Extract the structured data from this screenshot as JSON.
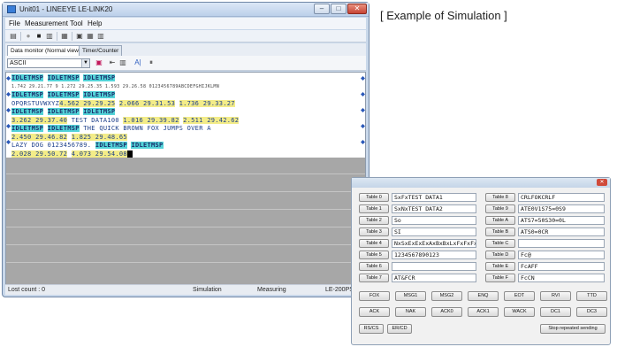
{
  "window": {
    "title": "Unit01 - LINEEYE LE-LINK20",
    "min": "–",
    "max": "□",
    "close": "✕"
  },
  "menu": [
    "File",
    "Measurement",
    "Tool",
    "Help"
  ],
  "tabs": [
    "Data monitor (Normal view)",
    "Timer/Counter"
  ],
  "ascii_select": "ASCII",
  "toolbar_glyphs": {
    "save": "▤",
    "record": "●",
    "stop": "■",
    "print": "▥",
    "copy": "▦",
    "find": "▣",
    "pause": "⏸",
    "ai": "A|",
    "filter": "⇤"
  },
  "monitor_rows": [
    {
      "kind": "text",
      "segments": [
        {
          "c": "cyan",
          "t": "IDLE"
        },
        {
          "c": "cyan",
          "t": "TMSP"
        },
        {
          "c": "white",
          "t": " "
        },
        {
          "c": "cyan",
          "t": "IDLE"
        },
        {
          "c": "cyan",
          "t": "TMSP"
        },
        {
          "c": "white",
          "t": " "
        },
        {
          "c": "cyan",
          "t": "IDLE"
        },
        {
          "c": "cyan",
          "t": "TMSP"
        }
      ]
    },
    {
      "kind": "meta",
      "text": "1.742 29.21.77 9 1.272 29.25.35 1.593 29.26.58 0123456789ABCDEFGHIJKLMN"
    },
    {
      "kind": "text",
      "segments": [
        {
          "c": "white",
          "t": "                            "
        },
        {
          "c": "cyan",
          "t": "IDLE"
        },
        {
          "c": "cyan",
          "t": "TMSP"
        },
        {
          "c": "white",
          "t": " "
        },
        {
          "c": "cyan",
          "t": "IDLE"
        },
        {
          "c": "cyan",
          "t": "TMSP"
        },
        {
          "c": "white",
          "t": " "
        },
        {
          "c": "cyan",
          "t": "IDLE"
        },
        {
          "c": "cyan",
          "t": "TMSP"
        }
      ]
    },
    {
      "kind": "text",
      "segments": [
        {
          "c": "white",
          "t": "OPQRSTUVWXYZ"
        },
        {
          "c": "yellow",
          "t": "4.562 29.29.25"
        },
        {
          "c": "white",
          "t": "  "
        },
        {
          "c": "yellow",
          "t": "2.066 29.31.53"
        },
        {
          "c": "white",
          "t": "  "
        },
        {
          "c": "yellow",
          "t": "1.736 29.33.27"
        }
      ]
    },
    {
      "kind": "text",
      "segments": [
        {
          "c": "cyan",
          "t": "IDLE"
        },
        {
          "c": "cyan",
          "t": "TMSP"
        },
        {
          "c": "white",
          "t": "                          "
        },
        {
          "c": "cyan",
          "t": "IDLE"
        },
        {
          "c": "cyan",
          "t": "TMSP"
        },
        {
          "c": "white",
          "t": " "
        },
        {
          "c": "cyan",
          "t": "IDLE"
        },
        {
          "c": "cyan",
          "t": "TMSP"
        }
      ]
    },
    {
      "kind": "text",
      "segments": [
        {
          "c": "yellow",
          "t": "3.262 29.37.40"
        },
        {
          "c": "white",
          "t": "  TEST DATA100  "
        },
        {
          "c": "yellow",
          "t": "1.016 29.39.82"
        },
        {
          "c": "white",
          "t": "  "
        },
        {
          "c": "yellow",
          "t": "2.511 29.42.62"
        }
      ]
    },
    {
      "kind": "text",
      "segments": [
        {
          "c": "cyan",
          "t": "IDLE"
        },
        {
          "c": "cyan",
          "t": "TMSP"
        },
        {
          "c": "white",
          "t": " "
        },
        {
          "c": "cyan",
          "t": "IDLE"
        },
        {
          "c": "cyan",
          "t": "TMSP"
        },
        {
          "c": "white",
          "t": " THE QUICK BROWN FOX JUMPS OVER A"
        }
      ]
    },
    {
      "kind": "text",
      "segments": [
        {
          "c": "yellow",
          "t": "2.450 29.46.82"
        },
        {
          "c": "white",
          "t": "  "
        },
        {
          "c": "yellow",
          "t": "1.825 29.48.65"
        }
      ]
    },
    {
      "kind": "text",
      "segments": [
        {
          "c": "white",
          "t": "LAZY DOG 0123456789.  "
        },
        {
          "c": "cyan",
          "t": "IDLE"
        },
        {
          "c": "cyan",
          "t": "TMSP"
        },
        {
          "c": "white",
          "t": " "
        },
        {
          "c": "cyan",
          "t": "IDLE"
        },
        {
          "c": "cyan",
          "t": "TMSP"
        }
      ]
    },
    {
      "kind": "text",
      "segments": [
        {
          "c": "white",
          "t": "                      "
        },
        {
          "c": "yellow",
          "t": "2.028 29.50.72"
        },
        {
          "c": "white",
          "t": "  "
        },
        {
          "c": "yellow",
          "t": "4.073 29.54.08"
        },
        {
          "c": "cursor",
          "t": ""
        }
      ]
    }
  ],
  "status": {
    "lost": "Lost count : 0",
    "mode": "Simulation",
    "state": "Measuring",
    "model": "LE-200PS"
  },
  "caption": "[ Example of Simulation ]",
  "sim": {
    "close": "✕",
    "tables_left": [
      {
        "label": "Table 0",
        "value": "SxFxTEST DATA1"
      },
      {
        "label": "Table 1",
        "value": "SxNxTEST DATA2"
      },
      {
        "label": "Table 2",
        "value": "So"
      },
      {
        "label": "Table 3",
        "value": "SI"
      },
      {
        "label": "Table 4",
        "value": "NxSxExExExAxBxBxLxFxFxFx"
      },
      {
        "label": "Table 5",
        "value": "1234567890123"
      },
      {
        "label": "Table 6",
        "value": ""
      },
      {
        "label": "Table 7",
        "value": "AT&FCR"
      }
    ],
    "tables_right": [
      {
        "label": "Table 8",
        "value": "CRLFOKCRLF"
      },
      {
        "label": "Table 9",
        "value": "ATE0V1S75=0S9"
      },
      {
        "label": "Table A",
        "value": "ATS7=50S30=0L"
      },
      {
        "label": "Table B",
        "value": "ATS0=0CR"
      },
      {
        "label": "Table C",
        "value": ""
      },
      {
        "label": "Table D",
        "value": "Fc@"
      },
      {
        "label": "Table E",
        "value": "FcAFF"
      },
      {
        "label": "Table F",
        "value": "FcCN"
      }
    ],
    "buttons_row1": [
      "FOX",
      "MSG1",
      "MSG2",
      "ENQ",
      "EOT",
      "RVI",
      "TTD"
    ],
    "buttons_row2": [
      "ACK",
      "NAK",
      "ACK0",
      "ACK1",
      "WACK",
      "DC1",
      "DC3"
    ],
    "buttons_row3": [
      "RS/CS",
      "ER/CD",
      "Stop repeated sending"
    ]
  }
}
